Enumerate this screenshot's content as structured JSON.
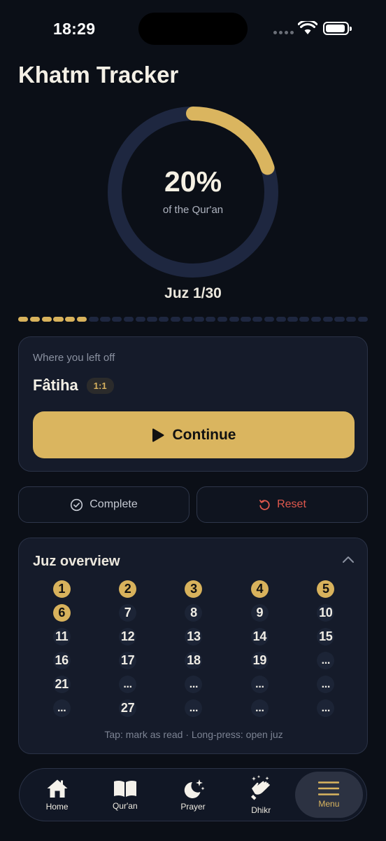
{
  "status": {
    "time": "18:29"
  },
  "title": "Khatm Tracker",
  "progress": {
    "percent_label": "20%",
    "percent": 20,
    "subtitle": "of the Qur'an",
    "juz_label": "Juz 1/30",
    "segments_total": 30,
    "segments_done": 6
  },
  "left_off": {
    "label": "Where you left off",
    "surah": "Fâtiha",
    "verse": "1:1",
    "continue_label": "Continue"
  },
  "actions": {
    "complete_label": "Complete",
    "reset_label": "Reset"
  },
  "overview": {
    "title": "Juz overview",
    "cells": [
      {
        "n": "1",
        "done": true
      },
      {
        "n": "2",
        "done": true
      },
      {
        "n": "3",
        "done": true
      },
      {
        "n": "4",
        "done": true
      },
      {
        "n": "5",
        "done": true
      },
      {
        "n": "6",
        "done": true
      },
      {
        "n": "7",
        "done": false
      },
      {
        "n": "8",
        "done": false
      },
      {
        "n": "9",
        "done": false
      },
      {
        "n": "10",
        "done": false
      },
      {
        "n": "11",
        "done": false
      },
      {
        "n": "12",
        "done": false
      },
      {
        "n": "13",
        "done": false
      },
      {
        "n": "14",
        "done": false
      },
      {
        "n": "15",
        "done": false
      },
      {
        "n": "16",
        "done": false
      },
      {
        "n": "17",
        "done": false
      },
      {
        "n": "18",
        "done": false
      },
      {
        "n": "19",
        "done": false
      },
      {
        "n": "...",
        "done": false
      },
      {
        "n": "21",
        "done": false
      },
      {
        "n": "...",
        "done": false
      },
      {
        "n": "...",
        "done": false
      },
      {
        "n": "...",
        "done": false
      },
      {
        "n": "...",
        "done": false
      },
      {
        "n": "...",
        "done": false
      },
      {
        "n": "27",
        "done": false
      },
      {
        "n": "...",
        "done": false
      },
      {
        "n": "...",
        "done": false
      },
      {
        "n": "...",
        "done": false
      }
    ],
    "hint": "Tap: mark as read · Long-press: open juz"
  },
  "tabs": [
    {
      "label": "Home",
      "icon": "home-icon",
      "active": false
    },
    {
      "label": "Qur'an",
      "icon": "book-icon",
      "active": false
    },
    {
      "label": "Prayer",
      "icon": "moon-stars-icon",
      "active": false
    },
    {
      "label": "Dhikr",
      "icon": "praying-hands-icon",
      "active": false
    },
    {
      "label": "Menu",
      "icon": "menu-icon",
      "active": true
    }
  ],
  "colors": {
    "accent": "#dab55f",
    "danger": "#e0584d",
    "track": "#1e2740",
    "background": "#0b0f17"
  }
}
